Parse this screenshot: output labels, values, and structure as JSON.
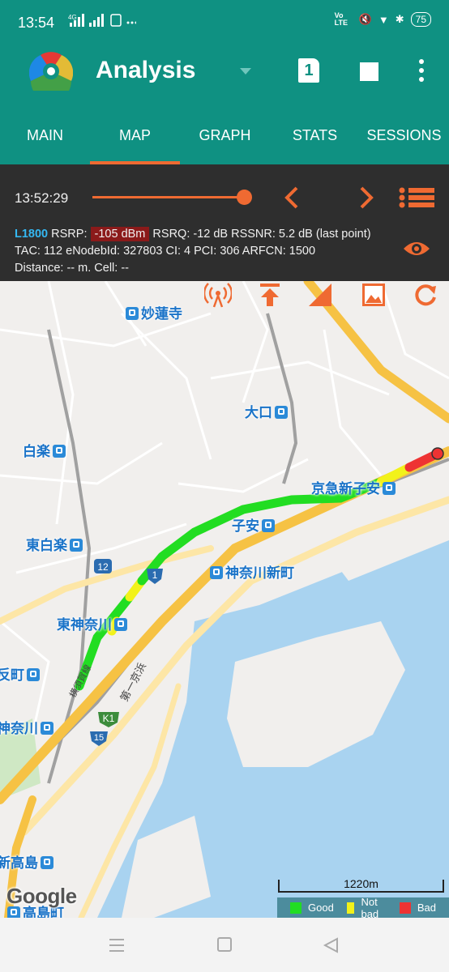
{
  "status_bar": {
    "time": "13:54",
    "network": "4G",
    "battery": "75",
    "volte": "Vo LTE"
  },
  "app_bar": {
    "title": "Analysis",
    "sim_number": "1"
  },
  "tabs": [
    {
      "label": "MAIN",
      "active": false
    },
    {
      "label": "MAP",
      "active": true
    },
    {
      "label": "GRAPH",
      "active": false
    },
    {
      "label": "STATS",
      "active": false
    },
    {
      "label": "SESSIONS",
      "active": false
    }
  ],
  "playback": {
    "time": "13:52:29",
    "progress": 1.0
  },
  "cell_info": {
    "tech": "L1800",
    "rsrp_label": "RSRP:",
    "rsrp_value": "-105 dBm",
    "rest_line1": "RSRQ: -12 dB  RSSNR: 5.2 dB  (last point)",
    "line2": "TAC: 112  eNodebId: 327803  CI: 4  PCI: 306  ARFCN: 1500",
    "line3": "Distance: -- m.   Cell: --"
  },
  "map": {
    "stations": {
      "myorenji": "妙蓮寺",
      "oguchi": "大口",
      "hakuraku": "白楽",
      "keikyu_shinkoyasu": "京急新子安",
      "koyasu": "子安",
      "higashi_hakuraku": "東白楽",
      "kanagawa_shinmachi": "神奈川新町",
      "higashi_kanagawa": "東神奈川",
      "tanmachi": "反町",
      "kanagawa": "神奈川",
      "shin_takashima": "新高島",
      "takashimacho": "高島町"
    },
    "road_shields": {
      "r12": "12",
      "r1": "1",
      "k1": "K1",
      "r15": "15"
    },
    "line_label": "横須賀線",
    "road_label": "第一京浜",
    "scale": "1220m",
    "attribution": "Google",
    "legend": [
      {
        "label": "Good",
        "color": "#22dd22"
      },
      {
        "label": "Not bad",
        "color": "#f2f21a"
      },
      {
        "label": "Bad",
        "color": "#ee3333"
      }
    ]
  }
}
